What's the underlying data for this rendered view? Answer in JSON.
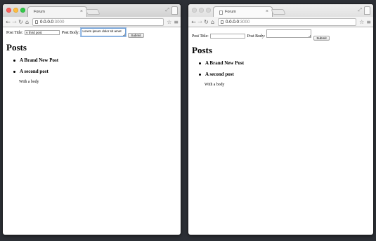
{
  "colors": {
    "desktop": "#2d3036",
    "close": "#fc605c",
    "minimize": "#fdbc40",
    "zoom": "#34c84a",
    "focus_ring": "#6c9dd6"
  },
  "windows": [
    {
      "tab_title": "Forum",
      "tab_close": "×",
      "url_host": "0.0.0.0",
      "url_port": ":3000",
      "form": {
        "title_label": "Post Title:",
        "title_value": "A third post",
        "body_label": "Post Body:",
        "body_value": "Lorem ipsum dolor sit amet",
        "submit_label": "Submit"
      },
      "heading": "Posts",
      "posts": [
        {
          "title": "A Brand New Post",
          "body": ""
        },
        {
          "title": "A second post",
          "body": "With a body"
        }
      ]
    },
    {
      "tab_title": "Forum",
      "tab_close": "×",
      "url_host": "0.0.0.0",
      "url_port": ":3000",
      "form": {
        "title_label": "Post Title:",
        "title_value": "",
        "body_label": "Post Body:",
        "body_value": "",
        "submit_label": "Submit"
      },
      "heading": "Posts",
      "posts": [
        {
          "title": "A Brand New Post",
          "body": ""
        },
        {
          "title": "A second post",
          "body": "With a body"
        }
      ]
    }
  ],
  "icons": {
    "back": "back-arrow-icon",
    "forward": "forward-arrow-icon",
    "reload": "reload-icon",
    "home": "home-icon",
    "bookmark": "star-icon",
    "menu": "hamburger-menu-icon",
    "fullscreen": "fullscreen-icon"
  }
}
